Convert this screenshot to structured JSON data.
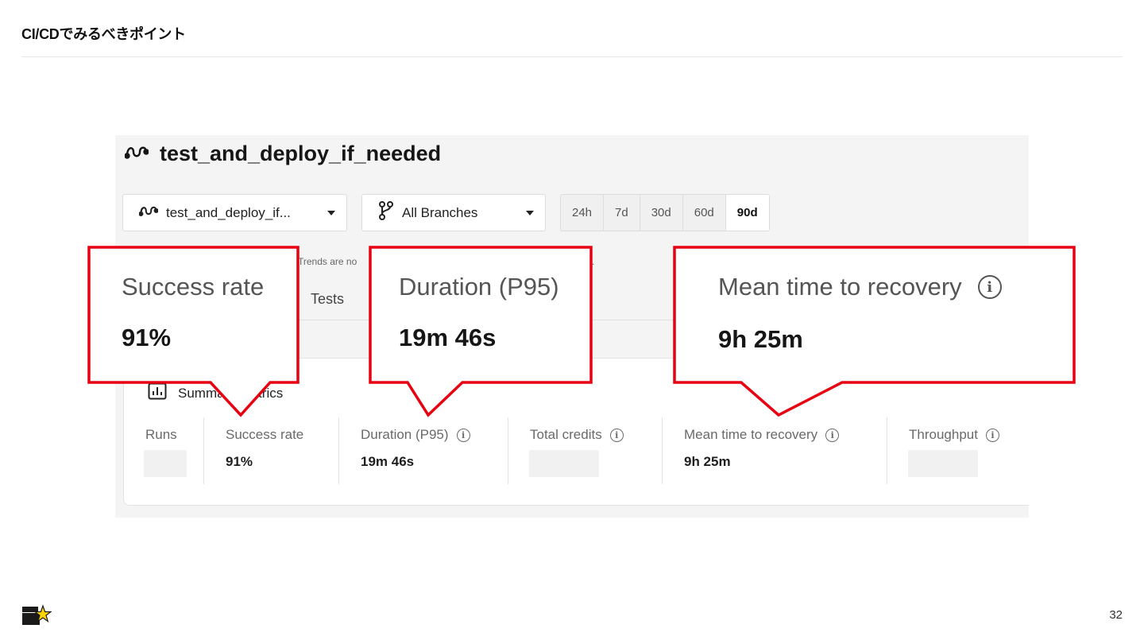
{
  "slide": {
    "title": "CI/CDでみるべきポイント",
    "page_number": "32"
  },
  "workflow": {
    "title": "test_and_deploy_if_needed",
    "selector_label": "test_and_deploy_if...",
    "branch_label": "All Branches",
    "time_ranges": [
      "24h",
      "7d",
      "30d",
      "60d",
      "90d"
    ],
    "active_range": "90d",
    "note_text": "Trends are no",
    "note_tail": ".",
    "tests_tab": "Tests",
    "summary_title": "Summary metrics"
  },
  "metrics": {
    "runs_label": "Runs",
    "success_label": "Success rate",
    "success_value": "91%",
    "duration_label": "Duration (P95)",
    "duration_value": "19m 46s",
    "credits_label": "Total credits",
    "mttr_label": "Mean time to recovery",
    "mttr_value": "9h 25m",
    "throughput_label": "Throughput"
  },
  "callouts": {
    "success": {
      "label": "Success rate",
      "value": "91%"
    },
    "duration": {
      "label": "Duration (P95)",
      "value": "19m 46s"
    },
    "mttr": {
      "label": "Mean time to recovery",
      "value": "9h 25m"
    }
  },
  "colors": {
    "callout_border": "#e60012",
    "logo_star": "#ffd400"
  },
  "icons": {
    "workflow": "workflow-icon",
    "branch": "git-branch-icon",
    "chart": "bar-chart-icon",
    "info": "info-icon"
  }
}
